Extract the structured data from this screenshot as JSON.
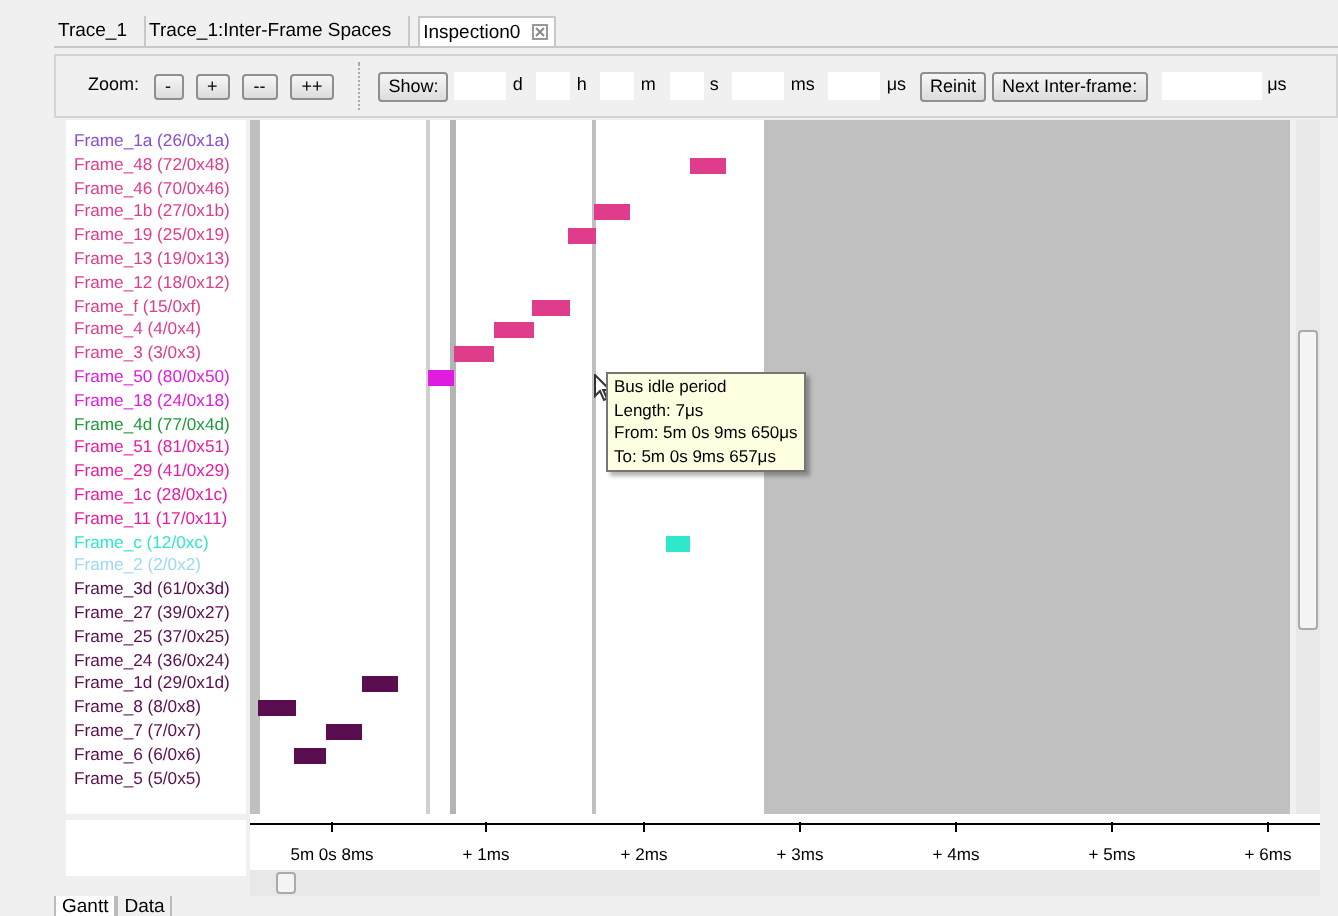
{
  "tabs": [
    {
      "label": "Trace_1",
      "selected": false,
      "closable": false
    },
    {
      "label": "Trace_1:Inter-Frame Spaces",
      "selected": false,
      "closable": false
    },
    {
      "label": "Inspection0",
      "selected": true,
      "closable": true
    }
  ],
  "toolbar": {
    "zoom_label": "Zoom:",
    "zoom_buttons": [
      "-",
      "+",
      "--",
      "++"
    ],
    "show_button": "Show:",
    "time_units": [
      "d",
      "h",
      "m",
      "s",
      "ms",
      "μs"
    ],
    "reinit_button": "Reinit",
    "next_button": "Next Inter-frame:",
    "next_unit": "μs"
  },
  "frames": [
    {
      "label": "Frame_1a (26/0x1a)",
      "color": "#8a4cd0"
    },
    {
      "label": "Frame_48 (72/0x48)",
      "color": "#e03c8c"
    },
    {
      "label": "Frame_46 (70/0x46)",
      "color": "#e03c8c"
    },
    {
      "label": "Frame_1b (27/0x1b)",
      "color": "#e03c8c"
    },
    {
      "label": "Frame_19 (25/0x19)",
      "color": "#e03c8c"
    },
    {
      "label": "Frame_13 (19/0x13)",
      "color": "#e03c8c"
    },
    {
      "label": "Frame_12 (18/0x12)",
      "color": "#e03c8c"
    },
    {
      "label": "Frame_f (15/0xf)",
      "color": "#e03c8c"
    },
    {
      "label": "Frame_4 (4/0x4)",
      "color": "#e03c8c"
    },
    {
      "label": "Frame_3 (3/0x3)",
      "color": "#e03c8c"
    },
    {
      "label": "Frame_50 (80/0x50)",
      "color": "#e01ce0"
    },
    {
      "label": "Frame_18 (24/0x18)",
      "color": "#e01ce0"
    },
    {
      "label": "Frame_4d (77/0x4d)",
      "color": "#1e9a3c"
    },
    {
      "label": "Frame_51 (81/0x51)",
      "color": "#e81ca4"
    },
    {
      "label": "Frame_29 (41/0x29)",
      "color": "#e81ca4"
    },
    {
      "label": "Frame_1c (28/0x1c)",
      "color": "#e81ca4"
    },
    {
      "label": "Frame_11 (17/0x11)",
      "color": "#e81ca4"
    },
    {
      "label": "Frame_c (12/0xc)",
      "color": "#2ee8c8"
    },
    {
      "label": "Frame_2 (2/0x2)",
      "color": "#9ed8f4"
    },
    {
      "label": "Frame_3d (61/0x3d)",
      "color": "#5a0e50"
    },
    {
      "label": "Frame_27 (39/0x27)",
      "color": "#5a0e50"
    },
    {
      "label": "Frame_25 (37/0x25)",
      "color": "#5a0e50"
    },
    {
      "label": "Frame_24 (36/0x24)",
      "color": "#5a0e50"
    },
    {
      "label": "Frame_1d (29/0x1d)",
      "color": "#5a0e50"
    },
    {
      "label": "Frame_8 (8/0x8)",
      "color": "#5a0e50"
    },
    {
      "label": "Frame_7 (7/0x7)",
      "color": "#5a0e50"
    },
    {
      "label": "Frame_6 (6/0x6)",
      "color": "#5a0e50"
    },
    {
      "label": "Frame_5 (5/0x5)",
      "color": "#5a0e50"
    }
  ],
  "tooltip": [
    "Bus idle period",
    "Length: 7μs",
    "From: 5m 0s 9ms 650μs",
    "To: 5m 0s 9ms 657μs"
  ],
  "axis_ticks": [
    "5m 0s 8ms",
    "+ 1ms",
    "+ 2ms",
    "+ 3ms",
    "+ 4ms",
    "+ 5ms",
    "+ 6ms"
  ],
  "bottom_tabs": [
    {
      "label": "Gantt",
      "selected": true
    },
    {
      "label": "Data",
      "selected": false
    }
  ]
}
